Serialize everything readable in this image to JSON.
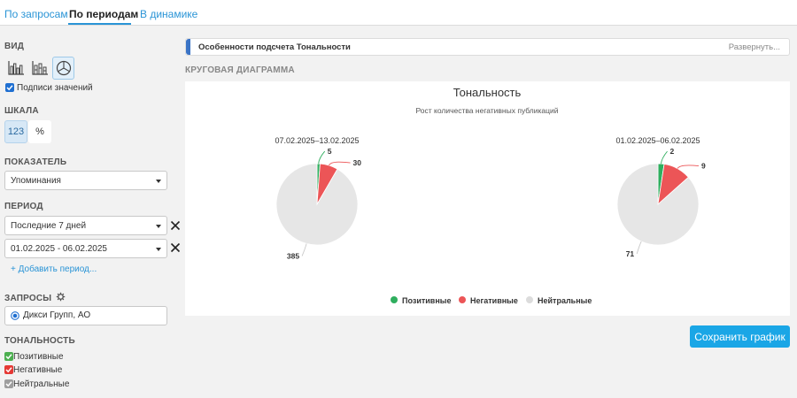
{
  "tabs": [
    "По запросам",
    "По периодам",
    "В динамике"
  ],
  "left": {
    "view_title": "ВИД",
    "value_labels": "Подписи значений",
    "scale_title": "ШКАЛА",
    "scale_abs": "123",
    "scale_pct": "%",
    "metric_title": "ПОКАЗАТЕЛЬ",
    "metric_value": "Упоминания",
    "period_title": "ПЕРИОД",
    "period1": "Последние 7 дней",
    "period2": "01.02.2025 - 06.02.2025",
    "add_period": "+ Добавить период...",
    "queries_title": "ЗАПРОСЫ",
    "query_value": "Дикси Групп, АО",
    "tonality_title": "ТОНАЛЬНОСТЬ",
    "tonality_items": [
      "Позитивные",
      "Негативные",
      "Нейтральные"
    ]
  },
  "info": {
    "label": "Особенности подсчета Тональности",
    "expand": "Развернуть..."
  },
  "chart_section_title": "КРУГОВАЯ ДИАГРАММА",
  "colors": {
    "positive": "#2fae5e",
    "negative": "#ec5557",
    "neutral": "#e6e6e6",
    "accent": "#1aa6e6",
    "positive_check": "#4caf50",
    "negative_check": "#e53935",
    "neutral_check": "#9e9e9e"
  },
  "chart_data": {
    "type": "pie",
    "title": "Тональность",
    "subtitle": "Рост количества негативных публикаций",
    "categories": [
      "Позитивные",
      "Негативные",
      "Нейтральные"
    ],
    "pies": [
      {
        "name": "07.02.2025–13.02.2025",
        "values": [
          5,
          30,
          385
        ]
      },
      {
        "name": "01.02.2025–06.02.2025",
        "values": [
          2,
          9,
          71
        ]
      }
    ],
    "legend": "bottom"
  },
  "save_label": "Сохранить график"
}
